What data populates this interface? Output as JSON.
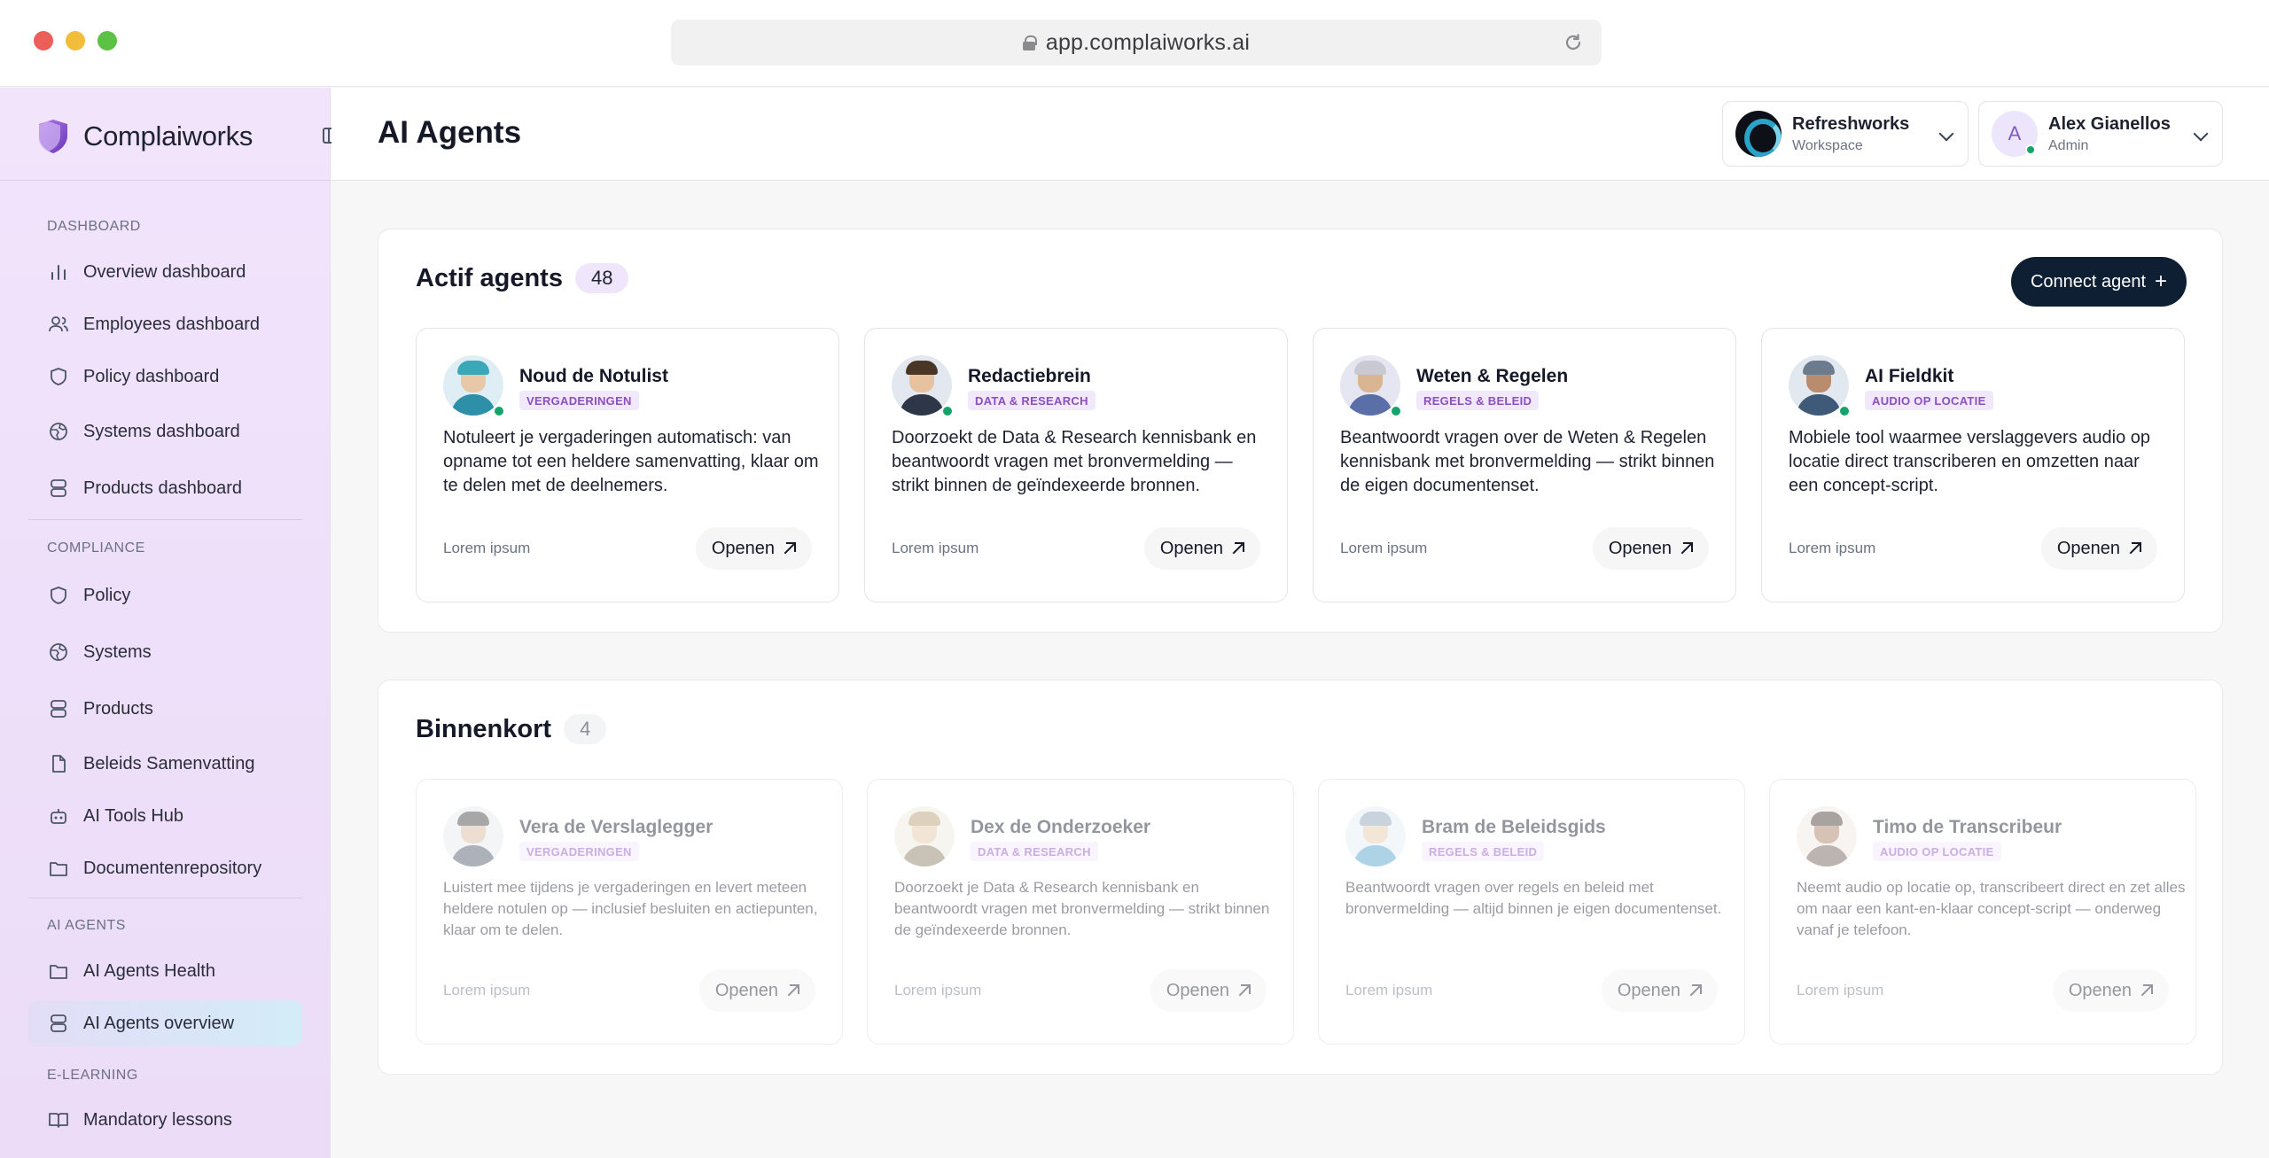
{
  "browser": {
    "url": "app.complaiworks.ai"
  },
  "sidebar": {
    "brand": "Complaiworks",
    "sections": [
      {
        "label": "DASHBOARD"
      },
      {
        "label": "COMPLIANCE"
      },
      {
        "label": "AI AGENTS"
      },
      {
        "label": "E-LEARNING"
      }
    ],
    "items": [
      {
        "label": "Overview dashboard",
        "icon": "bar-chart-icon"
      },
      {
        "label": "Employees dashboard",
        "icon": "users-icon"
      },
      {
        "label": "Policy dashboard",
        "icon": "shield-icon"
      },
      {
        "label": "Systems dashboard",
        "icon": "globe-icon"
      },
      {
        "label": "Products dashboard",
        "icon": "database-icon"
      },
      {
        "label": "Policy",
        "icon": "shield-icon"
      },
      {
        "label": "Systems",
        "icon": "globe-icon"
      },
      {
        "label": "Products",
        "icon": "database-icon"
      },
      {
        "label": "Beleids Samenvatting",
        "icon": "document-icon"
      },
      {
        "label": "AI Tools Hub",
        "icon": "robot-icon"
      },
      {
        "label": "Documentenrepository",
        "icon": "folder-icon"
      },
      {
        "label": "AI Agents Health",
        "icon": "folder-icon"
      },
      {
        "label": "AI Agents overview",
        "icon": "database-icon",
        "active": true
      },
      {
        "label": "Mandatory lessons",
        "icon": "book-icon"
      }
    ]
  },
  "header": {
    "title": "AI Agents",
    "workspace": {
      "name": "Refreshworks",
      "sub": "Workspace"
    },
    "user": {
      "name": "Alex Gianellos",
      "role": "Admin",
      "initial": "A"
    }
  },
  "active": {
    "title": "Actif agents",
    "count": "48",
    "connect_label": "Connect agent",
    "cards": [
      {
        "name": "Noud de Notulist",
        "tag": "VERGADERINGEN",
        "desc": "Notuleert je vergaderingen automatisch: van opname tot een heldere samenvatting, klaar om te delen met de deelnemers.",
        "foot": "Lorem ipsum",
        "open": "Openen"
      },
      {
        "name": "Redactiebrein",
        "tag": "DATA & RESEARCH",
        "desc": "Doorzoekt de Data & Research kennisbank en beantwoordt vragen met bronvermelding — strikt binnen de geïndexeerde bronnen.",
        "foot": "Lorem ipsum",
        "open": "Openen"
      },
      {
        "name": "Weten & Regelen",
        "tag": "REGELS & BELEID",
        "desc": "Beantwoordt vragen over de Weten & Regelen kennisbank met bronvermelding — strikt binnen de eigen documentenset.",
        "foot": "Lorem ipsum",
        "open": "Openen"
      },
      {
        "name": "AI Fieldkit",
        "tag": "AUDIO OP LOCATIE",
        "desc": "Mobiele tool waarmee verslaggevers audio op locatie direct transcriberen en omzetten naar een concept-script.",
        "foot": "Lorem ipsum",
        "open": "Openen"
      }
    ]
  },
  "soon": {
    "title": "Binnenkort",
    "count": "4",
    "cards": [
      {
        "name": "Vera de Verslaglegger",
        "tag": "VERGADERINGEN",
        "desc": "Luistert mee tijdens je vergaderingen en levert meteen heldere notulen op — inclusief besluiten en actiepunten, klaar om te delen.",
        "foot": "Lorem ipsum",
        "open": "Openen"
      },
      {
        "name": "Dex de Onderzoeker",
        "tag": "DATA & RESEARCH",
        "desc": "Doorzoekt je Data & Research kennisbank en beantwoordt vragen met bronvermelding — strikt binnen de geïndexeerde bronnen.",
        "foot": "Lorem ipsum",
        "open": "Openen"
      },
      {
        "name": "Bram de Beleidsgids",
        "tag": "REGELS & BELEID",
        "desc": "Beantwoordt vragen over regels en beleid met bronvermelding — altijd binnen je eigen documentenset.",
        "foot": "Lorem ipsum",
        "open": "Openen"
      },
      {
        "name": "Timo de Transcribeur",
        "tag": "AUDIO OP LOCATIE",
        "desc": "Neemt audio op locatie op, transcribeert direct en zet alles om naar een kant-en-klaar concept-script — onderweg vanaf je telefoon.",
        "foot": "Lorem ipsum",
        "open": "Openen"
      }
    ]
  },
  "colors": {
    "accent": "#0f1f33",
    "tag_text": "#8b4fc0",
    "tag_bg": "#f2e8fb",
    "online": "#14a36a"
  }
}
